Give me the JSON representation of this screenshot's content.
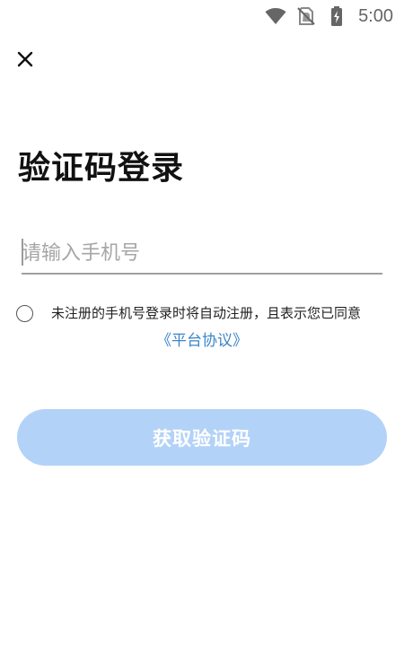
{
  "status_bar": {
    "time": "5:00",
    "icons": [
      "wifi-icon",
      "no-sim-icon",
      "battery-charging-icon"
    ]
  },
  "close_icon": "close-icon",
  "title": "验证码登录",
  "phone_input": {
    "placeholder": "请输入手机号",
    "value": ""
  },
  "agreement": {
    "checked": false,
    "text": "未注册的手机号登录时将自动注册，且表示您已同意",
    "link_text": "《平台协议》"
  },
  "get_code_button": {
    "label": "获取验证码",
    "disabled": true
  },
  "colors": {
    "link": "#3a86c8",
    "button_disabled": "#b3d2f8",
    "button_text": "#ffffff",
    "underline": "#9e9e9e"
  }
}
